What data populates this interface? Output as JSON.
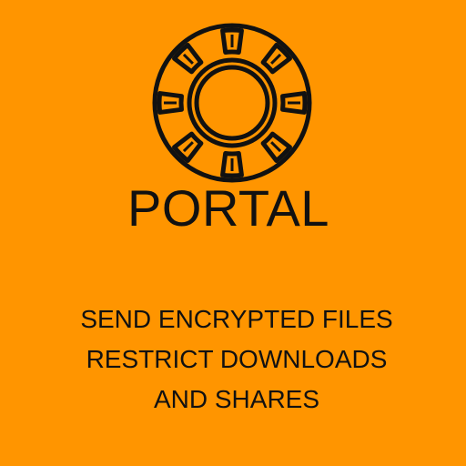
{
  "colors": {
    "background": "#FF9500",
    "foreground": "#111111"
  },
  "logo": {
    "icon": "portal-ring-icon"
  },
  "title": "PORTAL",
  "tagline": [
    "SEND ENCRYPTED FILES",
    "RESTRICT DOWNLOADS",
    "AND SHARES"
  ]
}
